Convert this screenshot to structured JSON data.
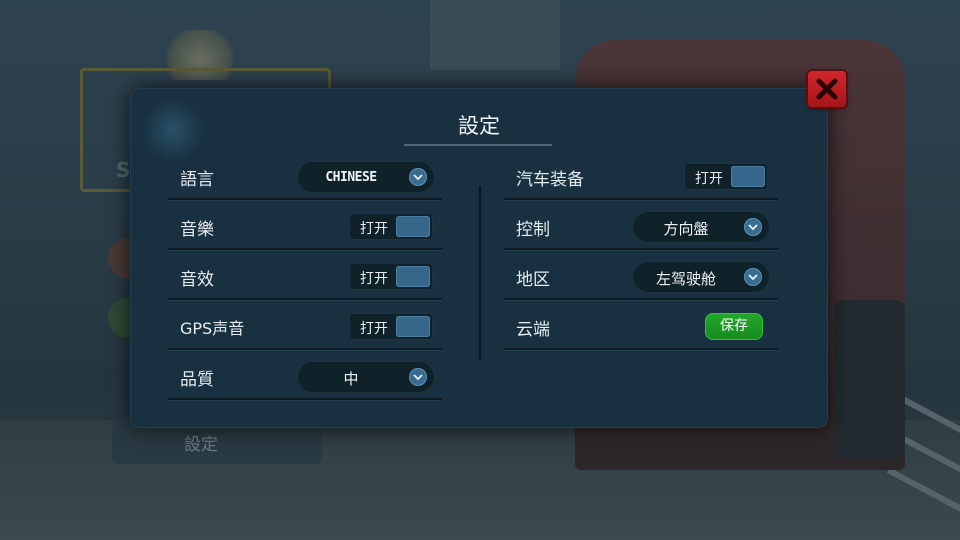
{
  "dialog": {
    "title": "設定",
    "close_icon": "close-icon"
  },
  "left_settings": [
    {
      "label": "語言",
      "control": "select",
      "value": "CHINESE"
    },
    {
      "label": "音樂",
      "control": "toggle",
      "value": "打开"
    },
    {
      "label": "音效",
      "control": "toggle",
      "value": "打开"
    },
    {
      "label": "GPS声音",
      "control": "toggle",
      "value": "打开"
    },
    {
      "label": "品質",
      "control": "select",
      "value": "中"
    }
  ],
  "right_settings": [
    {
      "label": "汽车装备",
      "control": "toggle",
      "value": "打开"
    },
    {
      "label": "控制",
      "control": "select",
      "value": "方向盤"
    },
    {
      "label": "地区",
      "control": "select",
      "value": "左驾驶舱"
    },
    {
      "label": "云端",
      "control": "button",
      "value": "保存"
    }
  ],
  "background": {
    "menu_label": "設定"
  },
  "colors": {
    "panel": "#18303f",
    "toggle_knob": "#37678a",
    "save_button": "#1a9a22",
    "close_button": "#c0201f"
  }
}
